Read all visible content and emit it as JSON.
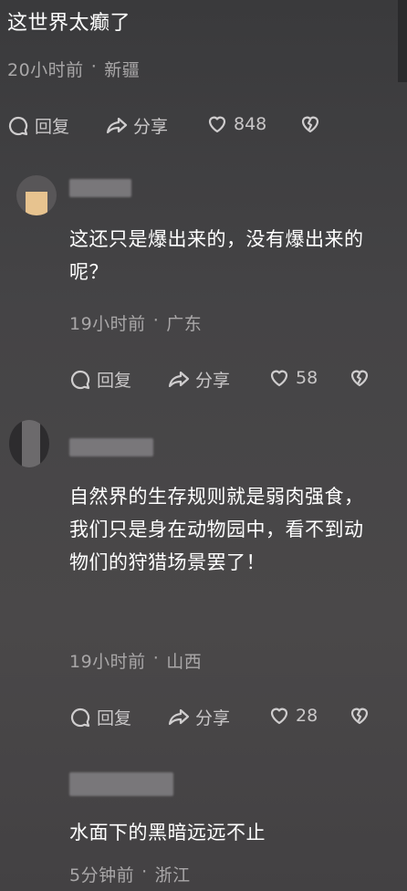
{
  "top_comment": {
    "text": "这世界太癫了",
    "time": "20小时前",
    "region": "新疆",
    "reply_label": "回复",
    "share_label": "分享",
    "likes": "848"
  },
  "comments": [
    {
      "text": "这还只是爆出来的，没有爆出来的呢？",
      "time": "19小时前",
      "region": "广东",
      "reply_label": "回复",
      "share_label": "分享",
      "likes": "58"
    },
    {
      "text": "自然界的生存规则就是弱肉强食，我们只是身在动物园中，看不到动物们的狩猎场景罢了！",
      "time": "19小时前",
      "region": "山西",
      "reply_label": "回复",
      "share_label": "分享",
      "likes": "28"
    },
    {
      "text": "水面下的黑暗远远不止",
      "time": "5分钟前",
      "region": "浙江"
    }
  ],
  "separator": "·",
  "icons": {
    "reply": "comment-bubble-icon",
    "share": "share-arrow-icon",
    "like": "heart-icon",
    "dislike": "broken-heart-icon"
  }
}
